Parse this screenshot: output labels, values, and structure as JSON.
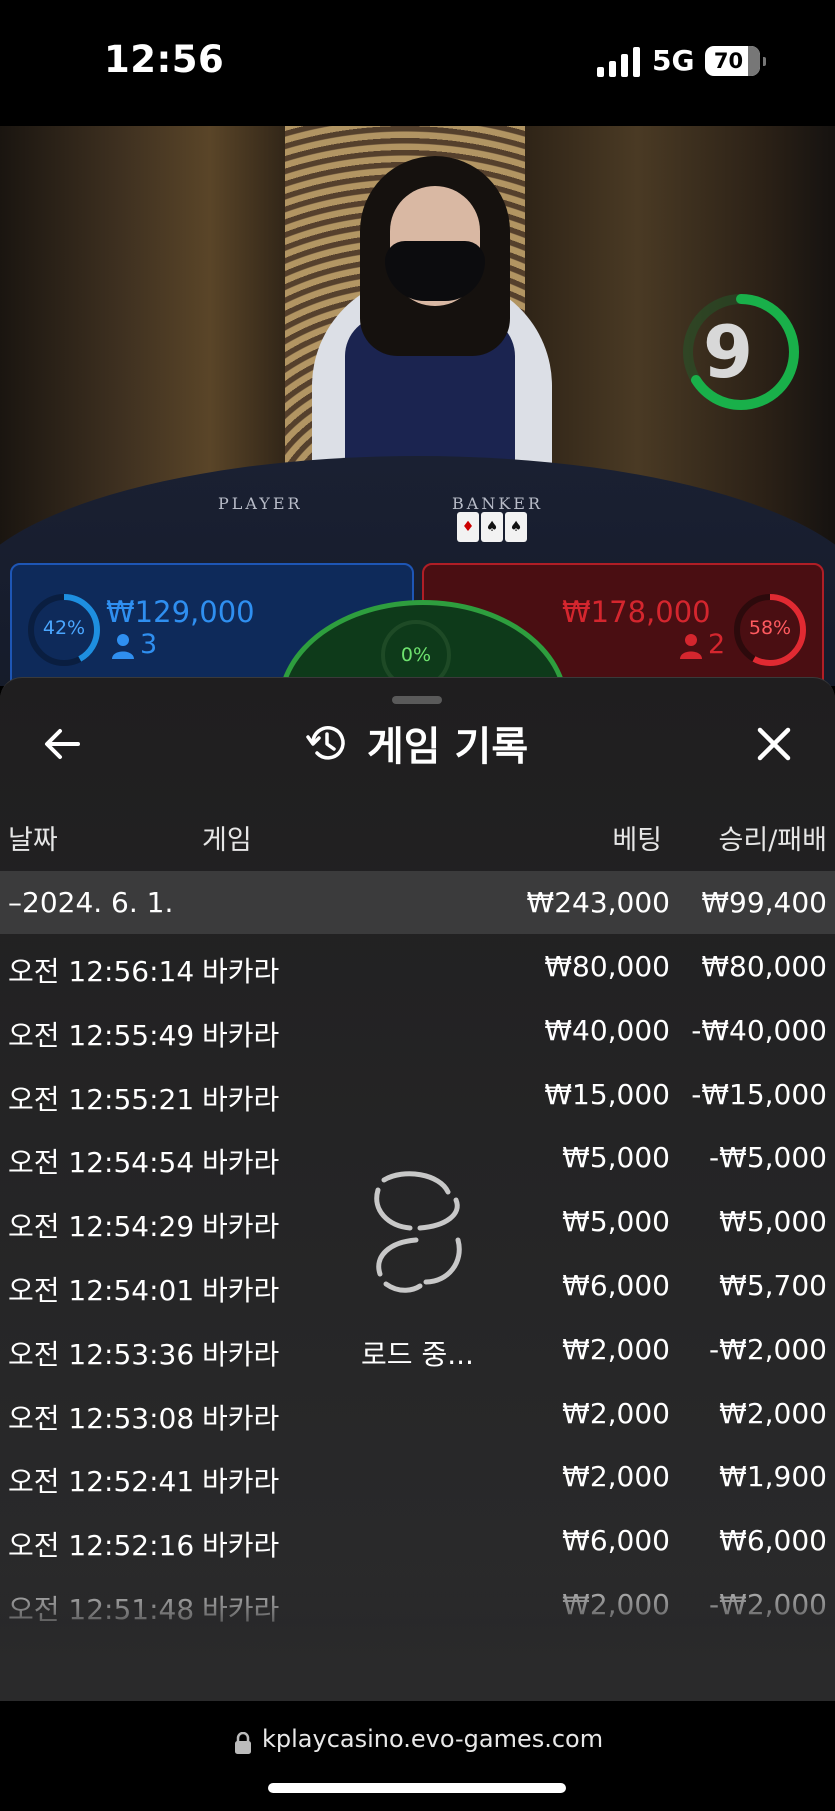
{
  "status_bar": {
    "time": "12:56",
    "network": "5G",
    "battery": "70"
  },
  "stream": {
    "timer": "9",
    "table_player_label": "PLAYER",
    "table_banker_label": "BANKER"
  },
  "bets": {
    "player": {
      "percent": "42%",
      "percent_value": 0.42,
      "amount": "₩129,000",
      "count": "3",
      "color": "#1e56b5"
    },
    "tie": {
      "percent": "0%",
      "percent_value": 0
    },
    "banker": {
      "percent": "58%",
      "percent_value": 0.58,
      "amount": "₩178,000",
      "count": "2",
      "color": "#c8242c"
    }
  },
  "history": {
    "title": "게임 기록",
    "columns": {
      "date": "날짜",
      "game": "게임",
      "bet": "베팅",
      "result": "승리/패배"
    },
    "summary": {
      "date": "–2024. 6. 1.",
      "bet": "₩243,000",
      "result": "₩99,400"
    },
    "rows": [
      {
        "time": "오전 12:56:14",
        "game": "바카라",
        "bet": "₩80,000",
        "result": "₩80,000"
      },
      {
        "time": "오전 12:55:49",
        "game": "바카라",
        "bet": "₩40,000",
        "result": "-₩40,000"
      },
      {
        "time": "오전 12:55:21",
        "game": "바카라",
        "bet": "₩15,000",
        "result": "-₩15,000"
      },
      {
        "time": "오전 12:54:54",
        "game": "바카라",
        "bet": "₩5,000",
        "result": "-₩5,000"
      },
      {
        "time": "오전 12:54:29",
        "game": "바카라",
        "bet": "₩5,000",
        "result": "₩5,000"
      },
      {
        "time": "오전 12:54:01",
        "game": "바카라",
        "bet": "₩6,000",
        "result": "₩5,700"
      },
      {
        "time": "오전 12:53:36",
        "game": "바카라",
        "bet": "₩2,000",
        "result": "-₩2,000"
      },
      {
        "time": "오전 12:53:08",
        "game": "바카라",
        "bet": "₩2,000",
        "result": "₩2,000"
      },
      {
        "time": "오전 12:52:41",
        "game": "바카라",
        "bet": "₩2,000",
        "result": "₩1,900"
      },
      {
        "time": "오전 12:52:16",
        "game": "바카라",
        "bet": "₩6,000",
        "result": "₩6,000"
      },
      {
        "time": "오전 12:51:48",
        "game": "바카라",
        "bet": "₩2,000",
        "result": "-₩2,000"
      }
    ],
    "loading_text": "로드 중..."
  },
  "browser": {
    "url": "kplaycasino.evo-games.com"
  }
}
